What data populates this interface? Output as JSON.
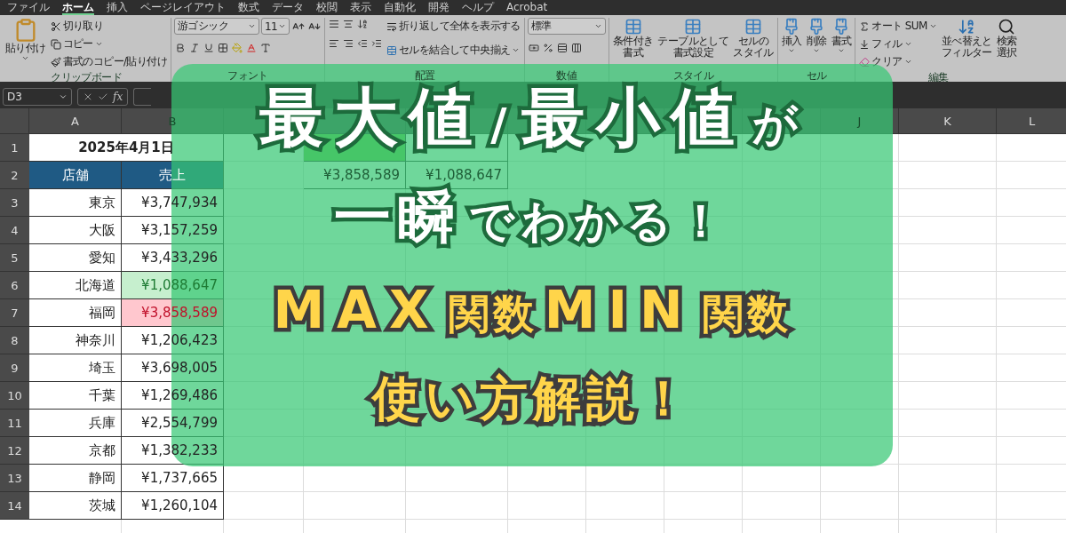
{
  "menu_tabs": [
    {
      "label": "ファイル",
      "selected": false
    },
    {
      "label": "ホーム",
      "selected": true
    },
    {
      "label": "挿入",
      "selected": false
    },
    {
      "label": "ページレイアウト",
      "selected": false
    },
    {
      "label": "数式",
      "selected": false
    },
    {
      "label": "データ",
      "selected": false
    },
    {
      "label": "校閲",
      "selected": false
    },
    {
      "label": "表示",
      "selected": false
    },
    {
      "label": "自動化",
      "selected": false
    },
    {
      "label": "開発",
      "selected": false
    },
    {
      "label": "ヘルプ",
      "selected": false
    },
    {
      "label": "Acrobat",
      "selected": false
    }
  ],
  "ribbon": {
    "clipboard": {
      "paste": "貼り付け",
      "cut": "切り取り",
      "copy": "コピー",
      "format_painter": "書式のコピー/貼り付け",
      "label": "クリップボード"
    },
    "font": {
      "name": "游ゴシック",
      "size": "11",
      "label": "フォント"
    },
    "alignment": {
      "wrap": "折り返して全体を表示する",
      "merge": "セルを結合して中央揃え",
      "label": "配置"
    },
    "number": {
      "format": "標準",
      "label": "数値"
    },
    "styles": {
      "buttons": [
        [
          "条件付き",
          "書式"
        ],
        [
          "テーブルとして",
          "書式設定"
        ],
        [
          "セルの",
          "スタイル"
        ]
      ],
      "label": "スタイル"
    },
    "cells": {
      "buttons": [
        "挿入",
        "削除",
        "書式"
      ],
      "label": "セル"
    },
    "editing": {
      "autosum": "オート SUM",
      "fill": "フィル",
      "clear": "クリア",
      "sort": [
        "並べ替えと",
        "フィルター"
      ],
      "find": [
        "検索",
        "選択"
      ],
      "label": "編集"
    }
  },
  "formula_bar": {
    "name_box": "D3",
    "fx": "fx"
  },
  "columns": [
    {
      "label": "A"
    },
    {
      "label": "B"
    },
    {},
    {},
    {},
    {},
    {},
    {},
    {},
    {
      "label": "J"
    },
    {
      "label": "K"
    },
    {
      "label": "L"
    }
  ],
  "row_numbers": [
    "1",
    "2",
    "3",
    "4",
    "5",
    "6",
    "7",
    "8",
    "9",
    "10",
    "11",
    "12",
    "13",
    "14"
  ],
  "sheet": {
    "date": "2025年4月1日",
    "headers": [
      "店舗",
      "売上"
    ],
    "records": [
      {
        "store": "東京",
        "sales": "¥3,747,934",
        "max": false,
        "min": false
      },
      {
        "store": "大阪",
        "sales": "¥3,157,259",
        "max": false,
        "min": false
      },
      {
        "store": "愛知",
        "sales": "¥3,433,296",
        "max": false,
        "min": false
      },
      {
        "store": "北海道",
        "sales": "¥1,088,647",
        "max": false,
        "min": true
      },
      {
        "store": "福岡",
        "sales": "¥3,858,589",
        "max": true,
        "min": false
      },
      {
        "store": "神奈川",
        "sales": "¥1,206,423",
        "max": false,
        "min": false
      },
      {
        "store": "埼玉",
        "sales": "¥3,698,005",
        "max": false,
        "min": false
      },
      {
        "store": "千葉",
        "sales": "¥1,269,486",
        "max": false,
        "min": false
      },
      {
        "store": "兵庫",
        "sales": "¥2,554,799",
        "max": false,
        "min": false
      },
      {
        "store": "京都",
        "sales": "¥1,382,233",
        "max": false,
        "min": false
      },
      {
        "store": "静岡",
        "sales": "¥1,737,665",
        "max": false,
        "min": false
      },
      {
        "store": "茨城",
        "sales": "¥1,260,104",
        "max": false,
        "min": false
      }
    ],
    "summary": {
      "headers": [
        {
          "filled": true
        },
        {
          "filled": false
        }
      ],
      "values": [
        "¥3,858,589",
        "¥1,088,647"
      ]
    }
  },
  "banner": {
    "lines": [
      {
        "kind": "white",
        "segments": [
          {
            "text": "最大値",
            "emphasis": true
          },
          {
            "text": "/",
            "emphasis": false
          },
          {
            "text": "最小値",
            "emphasis": true
          },
          {
            "text": "が",
            "emphasis": false
          }
        ]
      },
      {
        "kind": "white",
        "segments": [
          {
            "text": "一瞬",
            "emphasis": true
          },
          {
            "text": "でわかる！",
            "emphasis": false
          }
        ]
      },
      {
        "kind": "yellow",
        "segments": [
          {
            "text": "MAX",
            "emphasis": true
          },
          {
            "text": "関数",
            "emphasis": false
          },
          {
            "text": "MIN",
            "emphasis": true
          },
          {
            "text": "関数",
            "emphasis": false
          }
        ]
      },
      {
        "kind": "yellow",
        "segments": [
          {
            "text": "使い方解説！",
            "emphasis": true
          }
        ]
      }
    ]
  }
}
